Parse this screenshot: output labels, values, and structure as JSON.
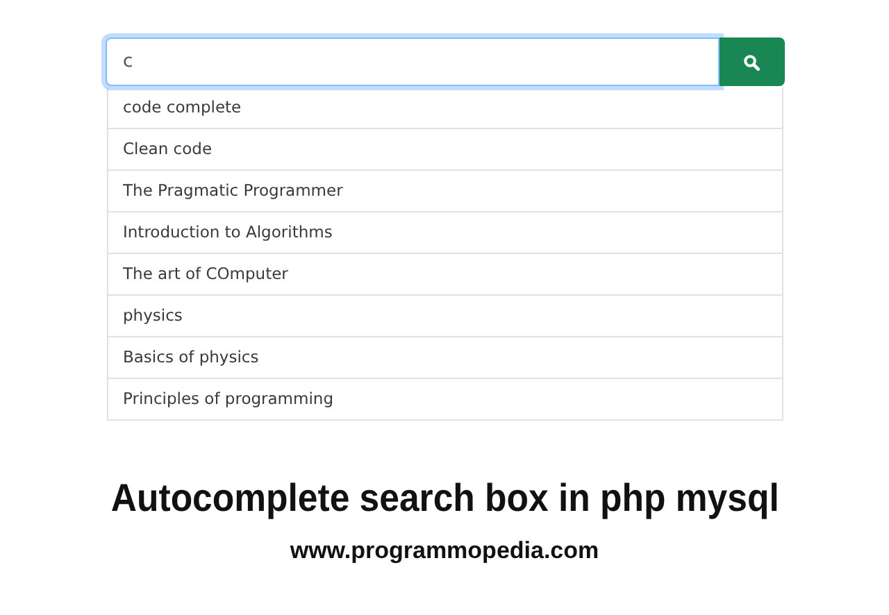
{
  "search": {
    "value": "c",
    "focused": true
  },
  "suggestions": [
    {
      "label": "code complete"
    },
    {
      "label": "Clean code"
    },
    {
      "label": "The Pragmatic Programmer"
    },
    {
      "label": "Introduction to Algorithms"
    },
    {
      "label": "The art of COmputer"
    },
    {
      "label": "physics"
    },
    {
      "label": "Basics of physics"
    },
    {
      "label": "Principles of programming"
    }
  ],
  "caption": {
    "title": "Autocomplete search box in php mysql",
    "site": "www.programmopedia.com"
  }
}
